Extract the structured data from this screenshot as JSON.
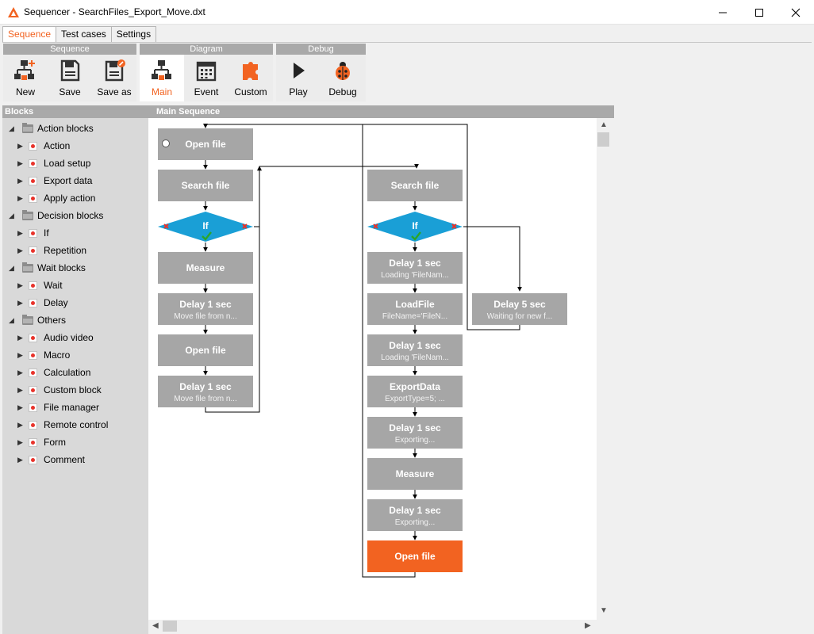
{
  "window": {
    "title": "Sequencer - SearchFiles_Export_Move.dxt",
    "minimize": "—",
    "maximize": "☐",
    "close": "✕"
  },
  "tabs": [
    {
      "label": "Sequence",
      "active": true
    },
    {
      "label": "Test cases",
      "active": false
    },
    {
      "label": "Settings",
      "active": false
    }
  ],
  "ribbon": {
    "groups": [
      {
        "title": "Sequence",
        "buttons": [
          {
            "label": "New",
            "icon": "new-sequence-icon"
          },
          {
            "label": "Save",
            "icon": "save-icon"
          },
          {
            "label": "Save as",
            "icon": "save-as-icon"
          }
        ]
      },
      {
        "title": "Diagram",
        "buttons": [
          {
            "label": "Main",
            "icon": "main-diagram-icon",
            "selected": true
          },
          {
            "label": "Event",
            "icon": "calendar-icon"
          },
          {
            "label": "Custom",
            "icon": "puzzle-icon"
          }
        ]
      },
      {
        "title": "Debug",
        "buttons": [
          {
            "label": "Play",
            "icon": "play-icon"
          },
          {
            "label": "Debug",
            "icon": "ladybug-icon"
          }
        ]
      }
    ]
  },
  "blocks_panel": {
    "title": "Blocks",
    "tree": [
      {
        "label": "Action blocks",
        "folder": true
      },
      {
        "label": "Action"
      },
      {
        "label": "Load setup"
      },
      {
        "label": "Export data"
      },
      {
        "label": "Apply action"
      },
      {
        "label": "Decision blocks",
        "folder": true
      },
      {
        "label": "If"
      },
      {
        "label": "Repetition"
      },
      {
        "label": "Wait blocks",
        "folder": true
      },
      {
        "label": "Wait"
      },
      {
        "label": "Delay"
      },
      {
        "label": "Others",
        "folder": true
      },
      {
        "label": "Audio video"
      },
      {
        "label": "Macro"
      },
      {
        "label": "Calculation"
      },
      {
        "label": "Custom block"
      },
      {
        "label": "File manager"
      },
      {
        "label": "Remote control"
      },
      {
        "label": "Form"
      },
      {
        "label": "Comment"
      }
    ]
  },
  "main_sequence": {
    "title": "Main Sequence",
    "col1": [
      {
        "title": "Open file",
        "sub": ""
      },
      {
        "title": "Search file",
        "sub": ""
      },
      {
        "title": "If",
        "sub": "",
        "type": "decision"
      },
      {
        "title": "Measure",
        "sub": ""
      },
      {
        "title": "Delay 1 sec",
        "sub": "Move file from n..."
      },
      {
        "title": "Open file",
        "sub": ""
      },
      {
        "title": "Delay 1 sec",
        "sub": "Move file from n..."
      }
    ],
    "col2": [
      {
        "title": "Search file",
        "sub": ""
      },
      {
        "title": "If",
        "sub": "",
        "type": "decision"
      },
      {
        "title": "Delay 1 sec",
        "sub": "Loading 'FileNam..."
      },
      {
        "title": "LoadFile",
        "sub": "FileName='FileN..."
      },
      {
        "title": "Delay 1 sec",
        "sub": "Loading 'FileNam..."
      },
      {
        "title": "ExportData",
        "sub": "ExportType=5; ..."
      },
      {
        "title": "Delay 1 sec",
        "sub": "Exporting..."
      },
      {
        "title": "Measure",
        "sub": ""
      },
      {
        "title": "Delay 1 sec",
        "sub": "Exporting..."
      },
      {
        "title": "Open file",
        "sub": "",
        "highlight": true
      }
    ],
    "col3": [
      {
        "title": "Delay 5 sec",
        "sub": "Waiting for new f..."
      }
    ]
  },
  "colors": {
    "accent": "#f26321",
    "block": "#a6a6a6",
    "decision": "#1a9fd6",
    "false_marker": "#e8332b",
    "true_marker": "#2aa52a"
  }
}
